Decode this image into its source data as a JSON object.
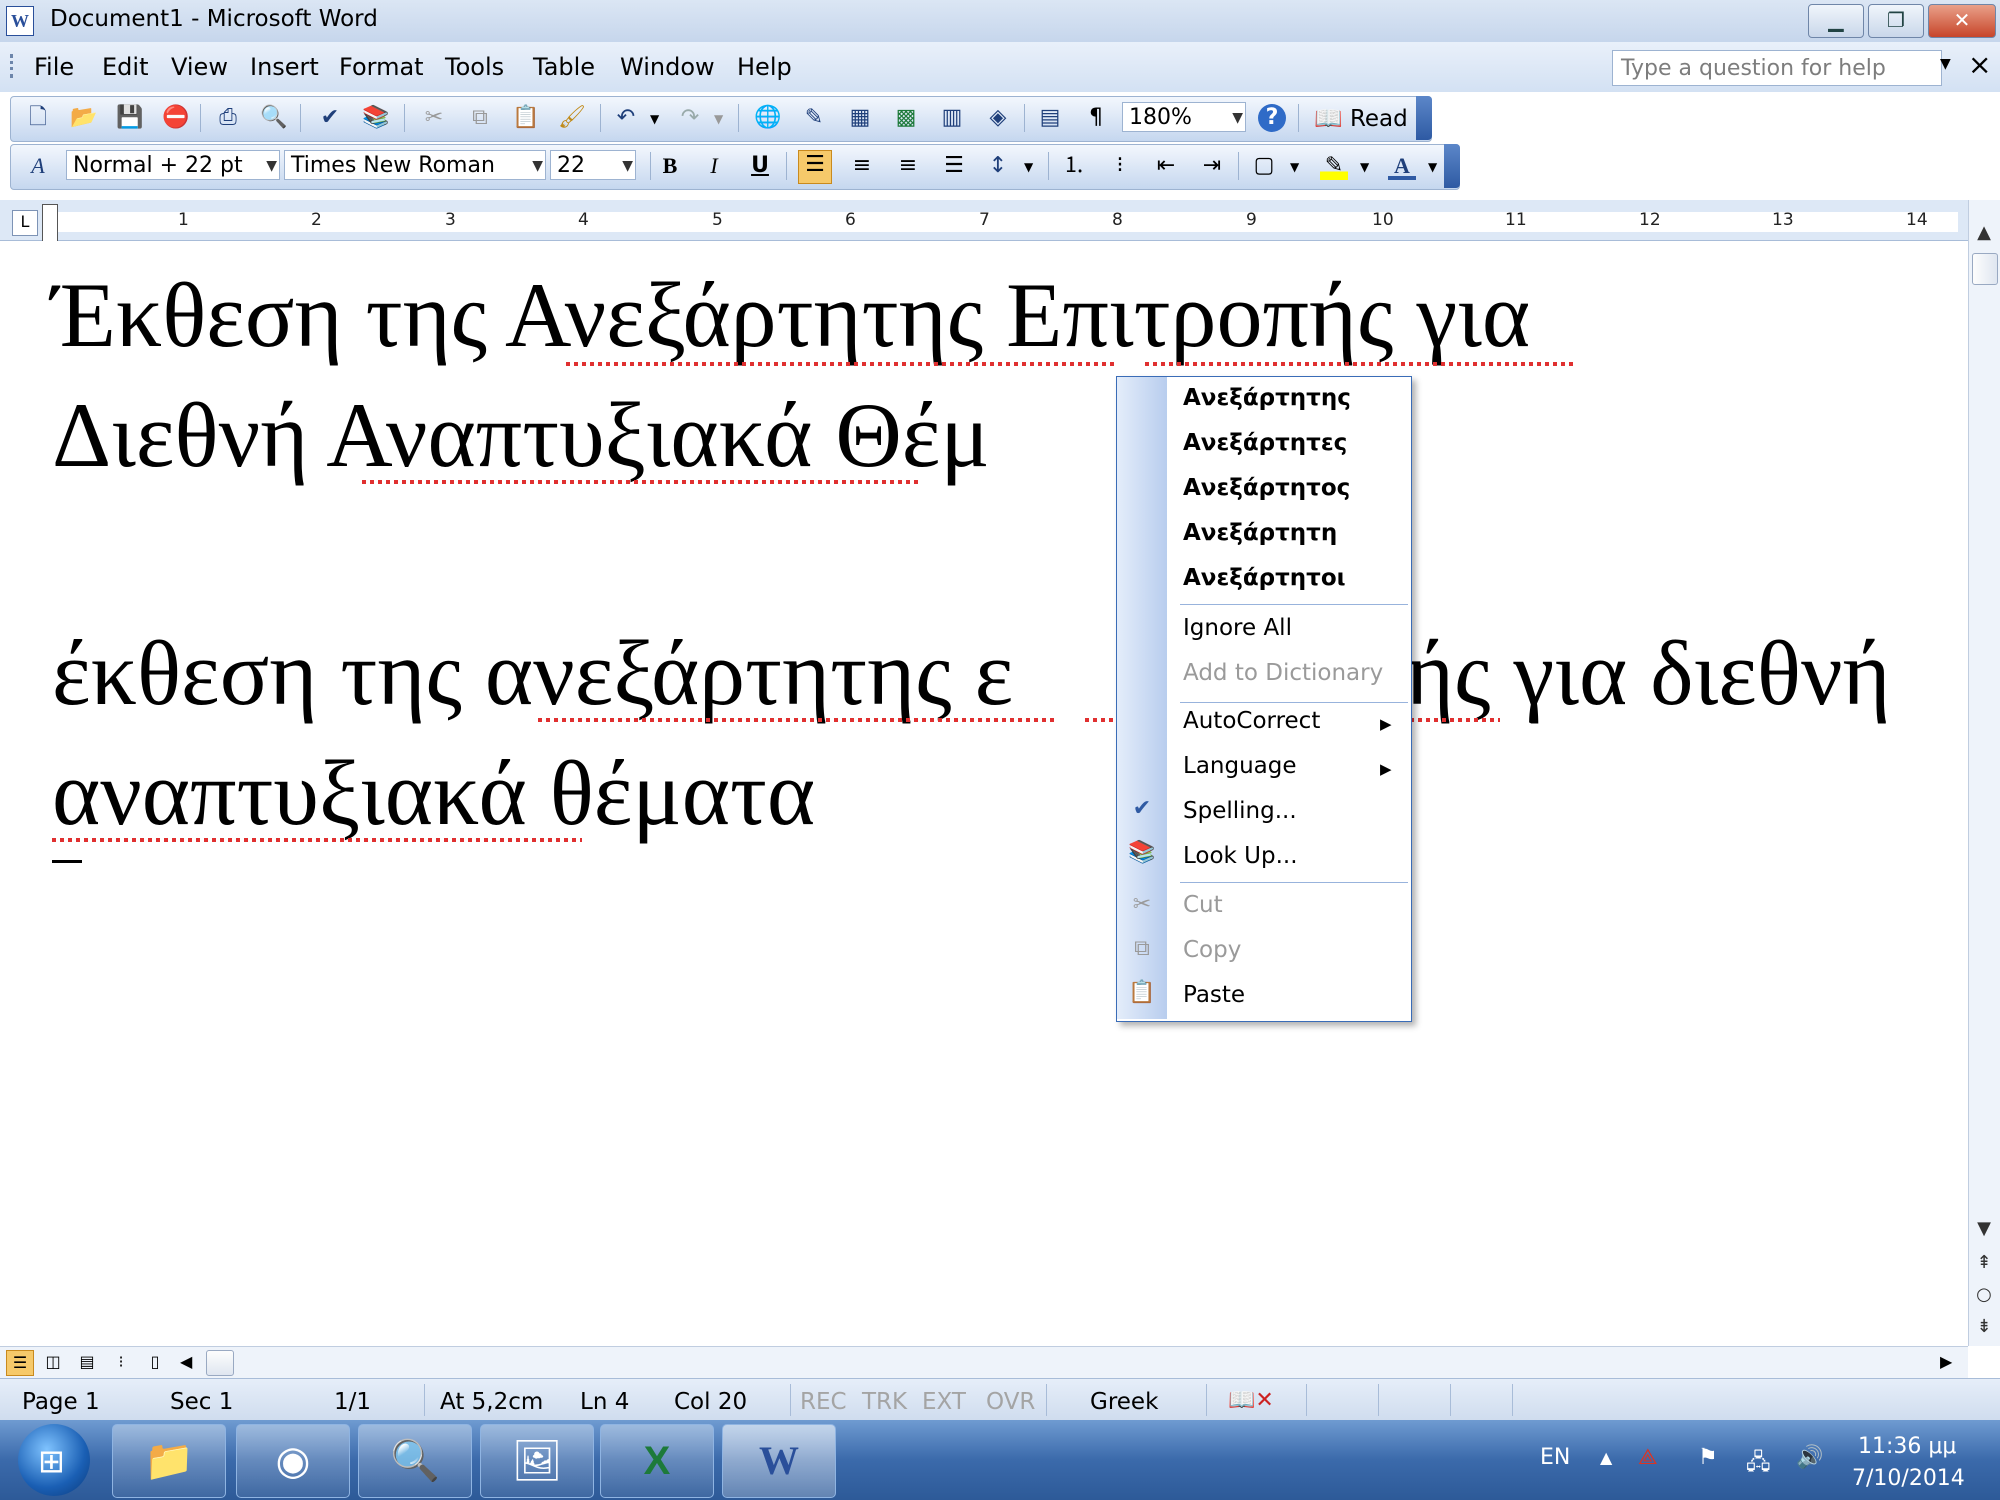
{
  "window": {
    "title": "Document1 - Microsoft Word",
    "app_icon": "word-icon",
    "controls": {
      "minimize": "minimize-icon",
      "restore": "restore-icon",
      "close": "close-icon"
    }
  },
  "menubar": {
    "items": [
      "File",
      "Edit",
      "View",
      "Insert",
      "Format",
      "Tools",
      "Table",
      "Window",
      "Help"
    ],
    "help_placeholder": "Type a question for help",
    "close_doc_glyph": "×"
  },
  "toolbar_standard": {
    "zoom": "180%",
    "read_label": "Read"
  },
  "toolbar_formatting": {
    "style": "Normal + 22 pt",
    "font": "Times New Roman",
    "size": "22",
    "bold": "B",
    "italic": "I",
    "underline": "U",
    "font_color_glyph": "A"
  },
  "ruler": {
    "numbers": [
      "1",
      "2",
      "3",
      "4",
      "5",
      "6",
      "7",
      "8",
      "9",
      "10",
      "11",
      "12",
      "13",
      "14"
    ]
  },
  "document": {
    "lines": [
      "Έκθεση της Ανεξάρτητης Επιτροπής για",
      "Διεθνή Αναπτυξιακά Θέμ",
      "έκθεση της ανεξάρτητης ε",
      "ής για διεθνή",
      "αναπτυξιακά θέματα"
    ]
  },
  "context_menu": {
    "suggestions": [
      "Ανεξάρτητης",
      "Ανεξάρτητες",
      "Ανεξάρτητος",
      "Ανεξάρτητη",
      "Ανεξάρτητοι"
    ],
    "ignore_all": "Ignore All",
    "add_to_dictionary": "Add to Dictionary",
    "autocorrect": "AutoCorrect",
    "language": "Language",
    "spelling": "Spelling...",
    "look_up": "Look Up...",
    "cut": "Cut",
    "copy": "Copy",
    "paste": "Paste"
  },
  "statusbar": {
    "page": "Page 1",
    "sec": "Sec 1",
    "pages": "1/1",
    "at": "At 5,2cm",
    "ln": "Ln 4",
    "col": "Col 20",
    "rec": "REC",
    "trk": "TRK",
    "ext": "EXT",
    "ovr": "OVR",
    "language": "Greek"
  },
  "taskbar": {
    "apps": [
      "explorer-icon",
      "chrome-icon",
      "search-app-icon",
      "photo-viewer-icon",
      "excel-icon",
      "word-icon"
    ],
    "lang": "EN",
    "time": "11:36 μμ",
    "date": "7/10/2014"
  }
}
